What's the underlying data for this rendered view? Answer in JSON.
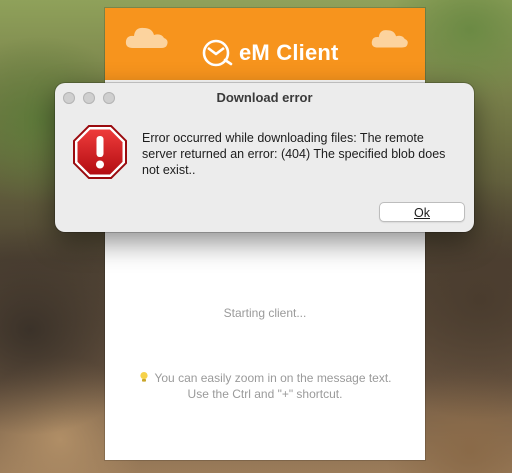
{
  "client": {
    "brand_name": "eM Client",
    "status_text": "Starting client...",
    "tip_line1": "You can easily zoom in on the message text.",
    "tip_line2": "Use the Ctrl and \"+\" shortcut.",
    "header_color": "#f7941d"
  },
  "dialog": {
    "title": "Download error",
    "message": "Error occurred while downloading files: The remote server returned an error: (404) The specified blob does not exist..",
    "ok_label": "Ok",
    "icon": "stop-sign-exclamation-icon"
  }
}
